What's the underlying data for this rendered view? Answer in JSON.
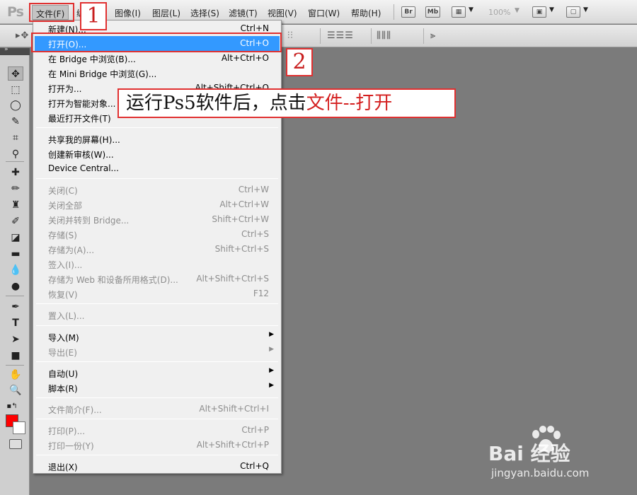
{
  "app": {
    "logo": "Ps"
  },
  "menubar": {
    "file": "文件(F)",
    "edit_fragment": "编",
    "image": "图像(I)",
    "layer": "图层(L)",
    "select": "选择(S)",
    "filter": "滤镜(T)",
    "view": "视图(V)",
    "window": "窗口(W)",
    "help": "帮助(H)",
    "bridge_btn": "Br",
    "minibridge_btn": "Mb",
    "zoom": "100%"
  },
  "file_menu": {
    "items": [
      {
        "label": "新建(N)...",
        "shortcut": "Ctrl+N"
      },
      {
        "label": "打开(O)...",
        "shortcut": "Ctrl+O"
      },
      {
        "label": "在 Bridge 中浏览(B)...",
        "shortcut": "Alt+Ctrl+O"
      },
      {
        "label": "在 Mini Bridge 中浏览(G)...",
        "shortcut": ""
      },
      {
        "label": "打开为...",
        "shortcut": "Alt+Shift+Ctrl+O"
      },
      {
        "label": "打开为智能对象...",
        "shortcut": ""
      },
      {
        "label": "最近打开文件(T)",
        "shortcut": ""
      },
      {
        "label": "共享我的屏幕(H)...",
        "shortcut": ""
      },
      {
        "label": "创建新审核(W)...",
        "shortcut": ""
      },
      {
        "label": "Device Central...",
        "shortcut": ""
      },
      {
        "label": "关闭(C)",
        "shortcut": "Ctrl+W"
      },
      {
        "label": "关闭全部",
        "shortcut": "Alt+Ctrl+W"
      },
      {
        "label": "关闭并转到 Bridge...",
        "shortcut": "Shift+Ctrl+W"
      },
      {
        "label": "存储(S)",
        "shortcut": "Ctrl+S"
      },
      {
        "label": "存储为(A)...",
        "shortcut": "Shift+Ctrl+S"
      },
      {
        "label": "签入(I)...",
        "shortcut": ""
      },
      {
        "label": "存储为 Web 和设备所用格式(D)...",
        "shortcut": "Alt+Shift+Ctrl+S"
      },
      {
        "label": "恢复(V)",
        "shortcut": "F12"
      },
      {
        "label": "置入(L)...",
        "shortcut": ""
      },
      {
        "label": "导入(M)",
        "shortcut": ""
      },
      {
        "label": "导出(E)",
        "shortcut": ""
      },
      {
        "label": "自动(U)",
        "shortcut": ""
      },
      {
        "label": "脚本(R)",
        "shortcut": ""
      },
      {
        "label": "文件简介(F)...",
        "shortcut": "Alt+Shift+Ctrl+I"
      },
      {
        "label": "打印(P)...",
        "shortcut": "Ctrl+P"
      },
      {
        "label": "打印一份(Y)",
        "shortcut": "Alt+Shift+Ctrl+P"
      },
      {
        "label": "退出(X)",
        "shortcut": "Ctrl+Q"
      }
    ]
  },
  "annotations": {
    "step1": "1",
    "step2": "2",
    "callout_part1": "运行Ps5软件后，点击",
    "callout_part2": "文件--打开"
  },
  "watermark": {
    "logo": "Bai  经验",
    "url": "jingyan.baidu.com"
  },
  "colors": {
    "foreground": "#ff0000",
    "background": "#ffffff",
    "highlight": "#3399ff",
    "annotation_red": "#e03030"
  }
}
